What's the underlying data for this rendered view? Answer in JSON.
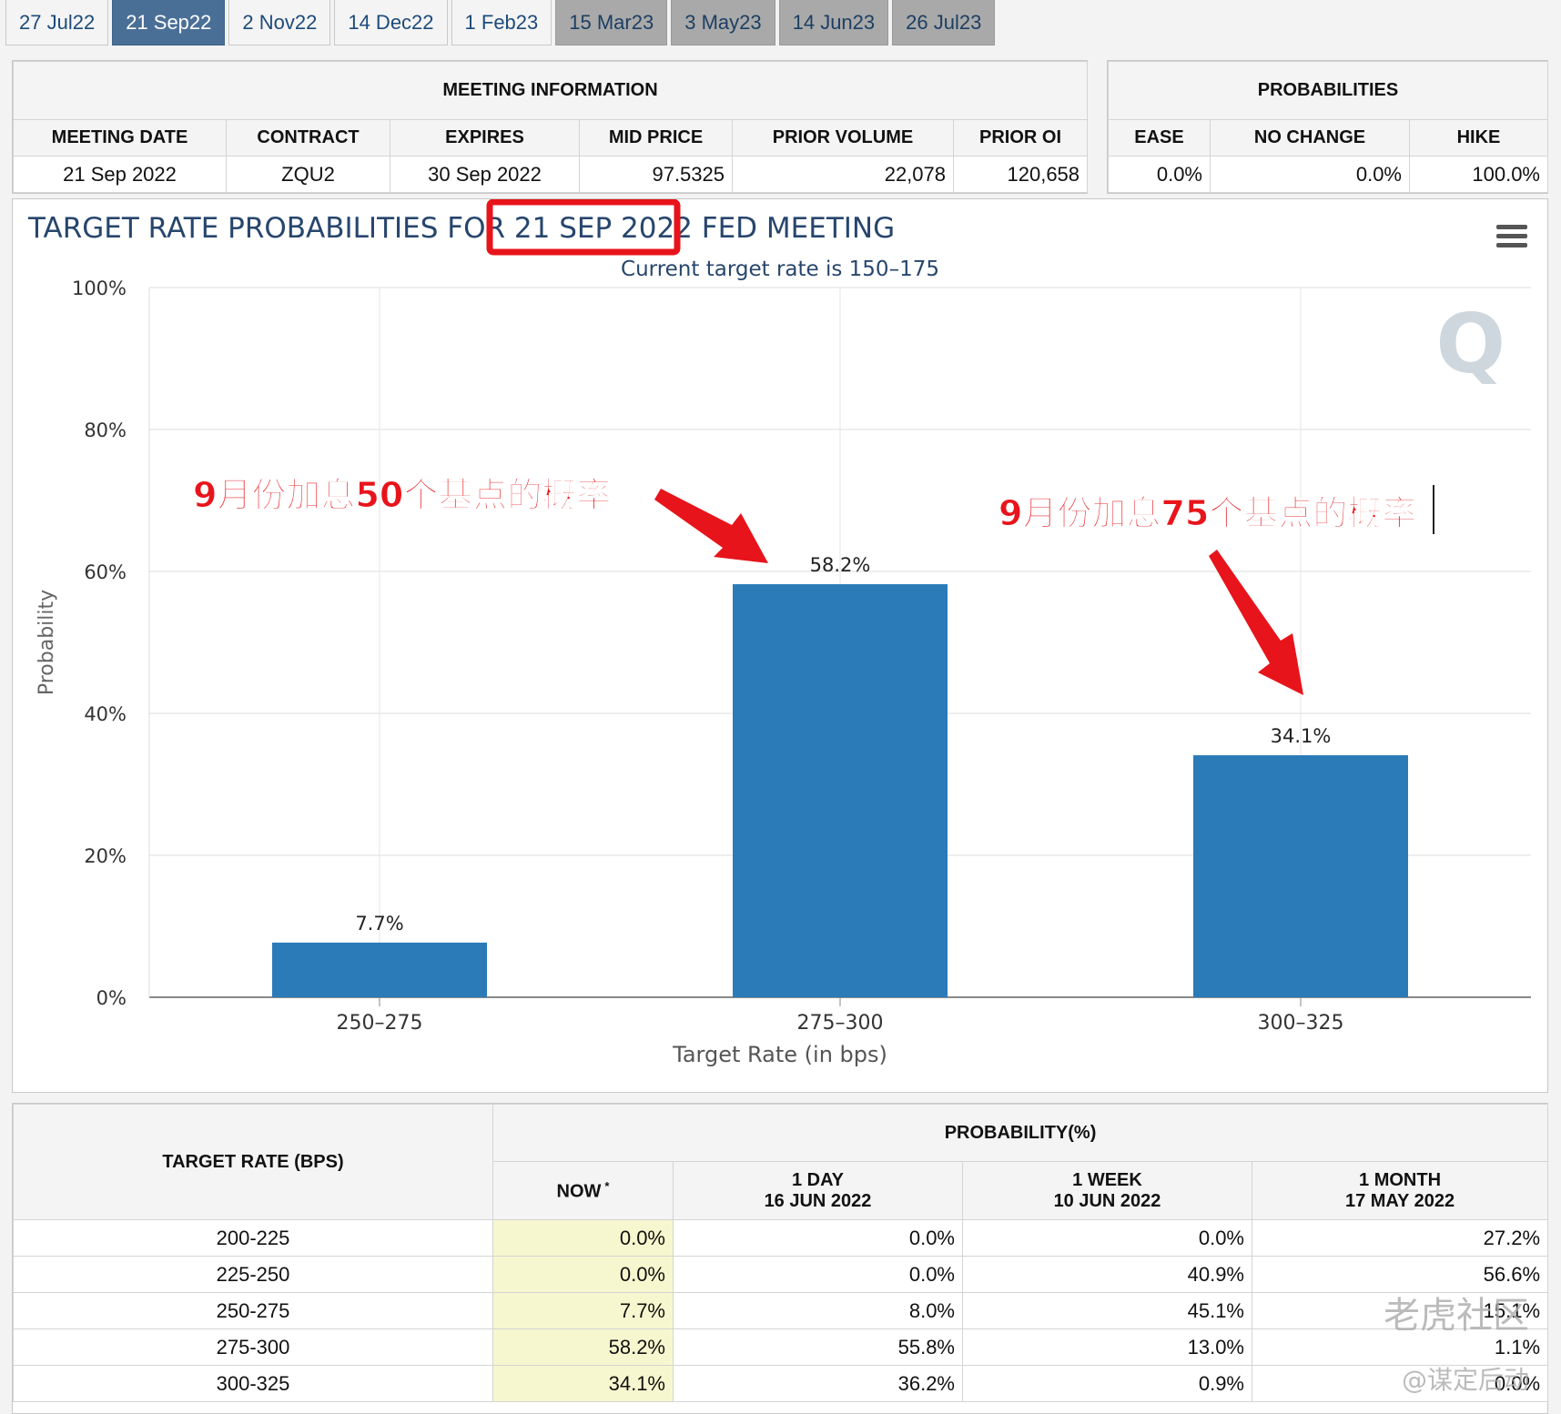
{
  "tabs": [
    {
      "label": "27 Jul22",
      "state": "normal"
    },
    {
      "label": "21 Sep22",
      "state": "active"
    },
    {
      "label": "2 Nov22",
      "state": "normal"
    },
    {
      "label": "14 Dec22",
      "state": "normal"
    },
    {
      "label": "1 Feb23",
      "state": "normal"
    },
    {
      "label": "15 Mar23",
      "state": "disabled"
    },
    {
      "label": "3 May23",
      "state": "disabled"
    },
    {
      "label": "14 Jun23",
      "state": "disabled"
    },
    {
      "label": "26 Jul23",
      "state": "disabled"
    }
  ],
  "meeting_info": {
    "title": "MEETING INFORMATION",
    "headers": [
      "MEETING DATE",
      "CONTRACT",
      "EXPIRES",
      "MID PRICE",
      "PRIOR VOLUME",
      "PRIOR OI"
    ],
    "row": [
      "21 Sep 2022",
      "ZQU2",
      "30 Sep 2022",
      "97.5325",
      "22,078",
      "120,658"
    ]
  },
  "probabilities": {
    "title": "PROBABILITIES",
    "headers": [
      "EASE",
      "NO CHANGE",
      "HIKE"
    ],
    "row": [
      "0.0%",
      "0.0%",
      "100.0%"
    ]
  },
  "chart_data": {
    "type": "bar",
    "title_prefix": "TARGET RATE PROBABILITIES FOR ",
    "title_highlight": "21 SEP 2022",
    "title_suffix": " FED MEETING",
    "subtitle": "Current target rate is 150–175",
    "xlabel": "Target Rate (in bps)",
    "ylabel": "Probability",
    "categories": [
      "250–275",
      "275–300",
      "300–325"
    ],
    "values": [
      7.7,
      58.2,
      34.1
    ],
    "data_labels": [
      "7.7%",
      "58.2%",
      "34.1%"
    ],
    "ylim": [
      0,
      100
    ],
    "yticks": [
      "0%",
      "20%",
      "40%",
      "60%",
      "80%",
      "100%"
    ],
    "grid": true,
    "bar_color": "#2b7bb9",
    "annotations": [
      "9月份加息50个基点的概率",
      "9月份加息75个基点的概率"
    ],
    "annotation_color": "#e8141b"
  },
  "rates_table": {
    "col_header": "TARGET RATE (BPS)",
    "group_header": "PROBABILITY(%)",
    "sub_headers": [
      {
        "line1": "NOW",
        "line2": ""
      },
      {
        "line1": "1 DAY",
        "line2": "16 JUN 2022"
      },
      {
        "line1": "1 WEEK",
        "line2": "10 JUN 2022"
      },
      {
        "line1": "1 MONTH",
        "line2": "17 MAY 2022"
      }
    ],
    "now_marker": "*",
    "rows": [
      [
        "200-225",
        "0.0%",
        "0.0%",
        "0.0%",
        "27.2%"
      ],
      [
        "225-250",
        "0.0%",
        "0.0%",
        "40.9%",
        "56.6%"
      ],
      [
        "250-275",
        "7.7%",
        "8.0%",
        "45.1%",
        "15.1%"
      ],
      [
        "275-300",
        "58.2%",
        "55.8%",
        "13.0%",
        "1.1%"
      ],
      [
        "300-325",
        "34.1%",
        "36.2%",
        "0.9%",
        "0.0%"
      ]
    ]
  },
  "watermark": {
    "line1": "老虎社区",
    "line2": "@谋定后动"
  }
}
